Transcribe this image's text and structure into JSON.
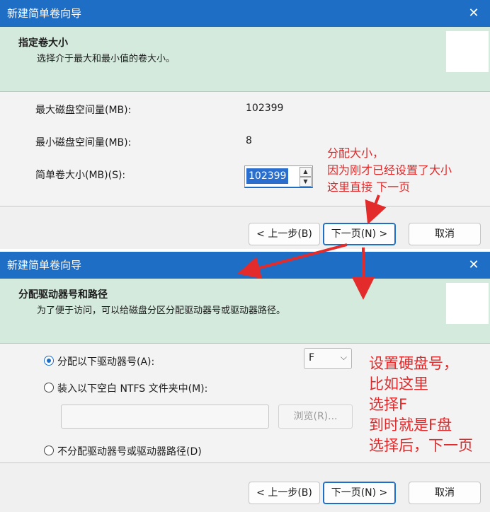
{
  "dialog1": {
    "title": "新建简单卷向导",
    "close_glyph": "✕",
    "header_title": "指定卷大小",
    "header_subtitle": "选择介于最大和最小值的卷大小。",
    "rows": [
      {
        "label": "最大磁盘空间量(MB):",
        "value": "102399"
      },
      {
        "label": "最小磁盘空间量(MB):",
        "value": "8"
      }
    ],
    "size_label": "简单卷大小(MB)(S):",
    "size_value": "102399",
    "back_button": "< 上一步(B)",
    "next_button": "下一页(N) >",
    "cancel_button": "取消"
  },
  "dialog2": {
    "title": "新建简单卷向导",
    "close_glyph": "✕",
    "header_title": "分配驱动器号和路径",
    "header_subtitle": "为了便于访问，可以给磁盘分区分配驱动器号或驱动器路径。",
    "option_assign": "分配以下驱动器号(A):",
    "option_mount": "装入以下空白 NTFS 文件夹中(M):",
    "option_none": "不分配驱动器号或驱动器路径(D)",
    "drive_letter": "F",
    "browse_button": "浏览(R)...",
    "back_button": "< 上一步(B)",
    "next_button": "下一页(N) >",
    "cancel_button": "取消"
  },
  "annotations": {
    "note1": [
      "分配大小，",
      "因为刚才已经设置了大小",
      "这里直接  下一页"
    ],
    "note2": [
      "设置硬盘号，",
      "比如这里",
      "选择F",
      "到时就是F盘",
      "选择后，下一页"
    ]
  },
  "colors": {
    "titlebar": "#1e6ec6",
    "header_bg": "#d4eadd",
    "annotation": "#e0292a",
    "selection": "#2b6fce"
  },
  "icons": {
    "close": "close-icon",
    "spin_up": "chevron-up-icon",
    "spin_down": "chevron-down-icon",
    "combo": "chevron-down-icon"
  }
}
